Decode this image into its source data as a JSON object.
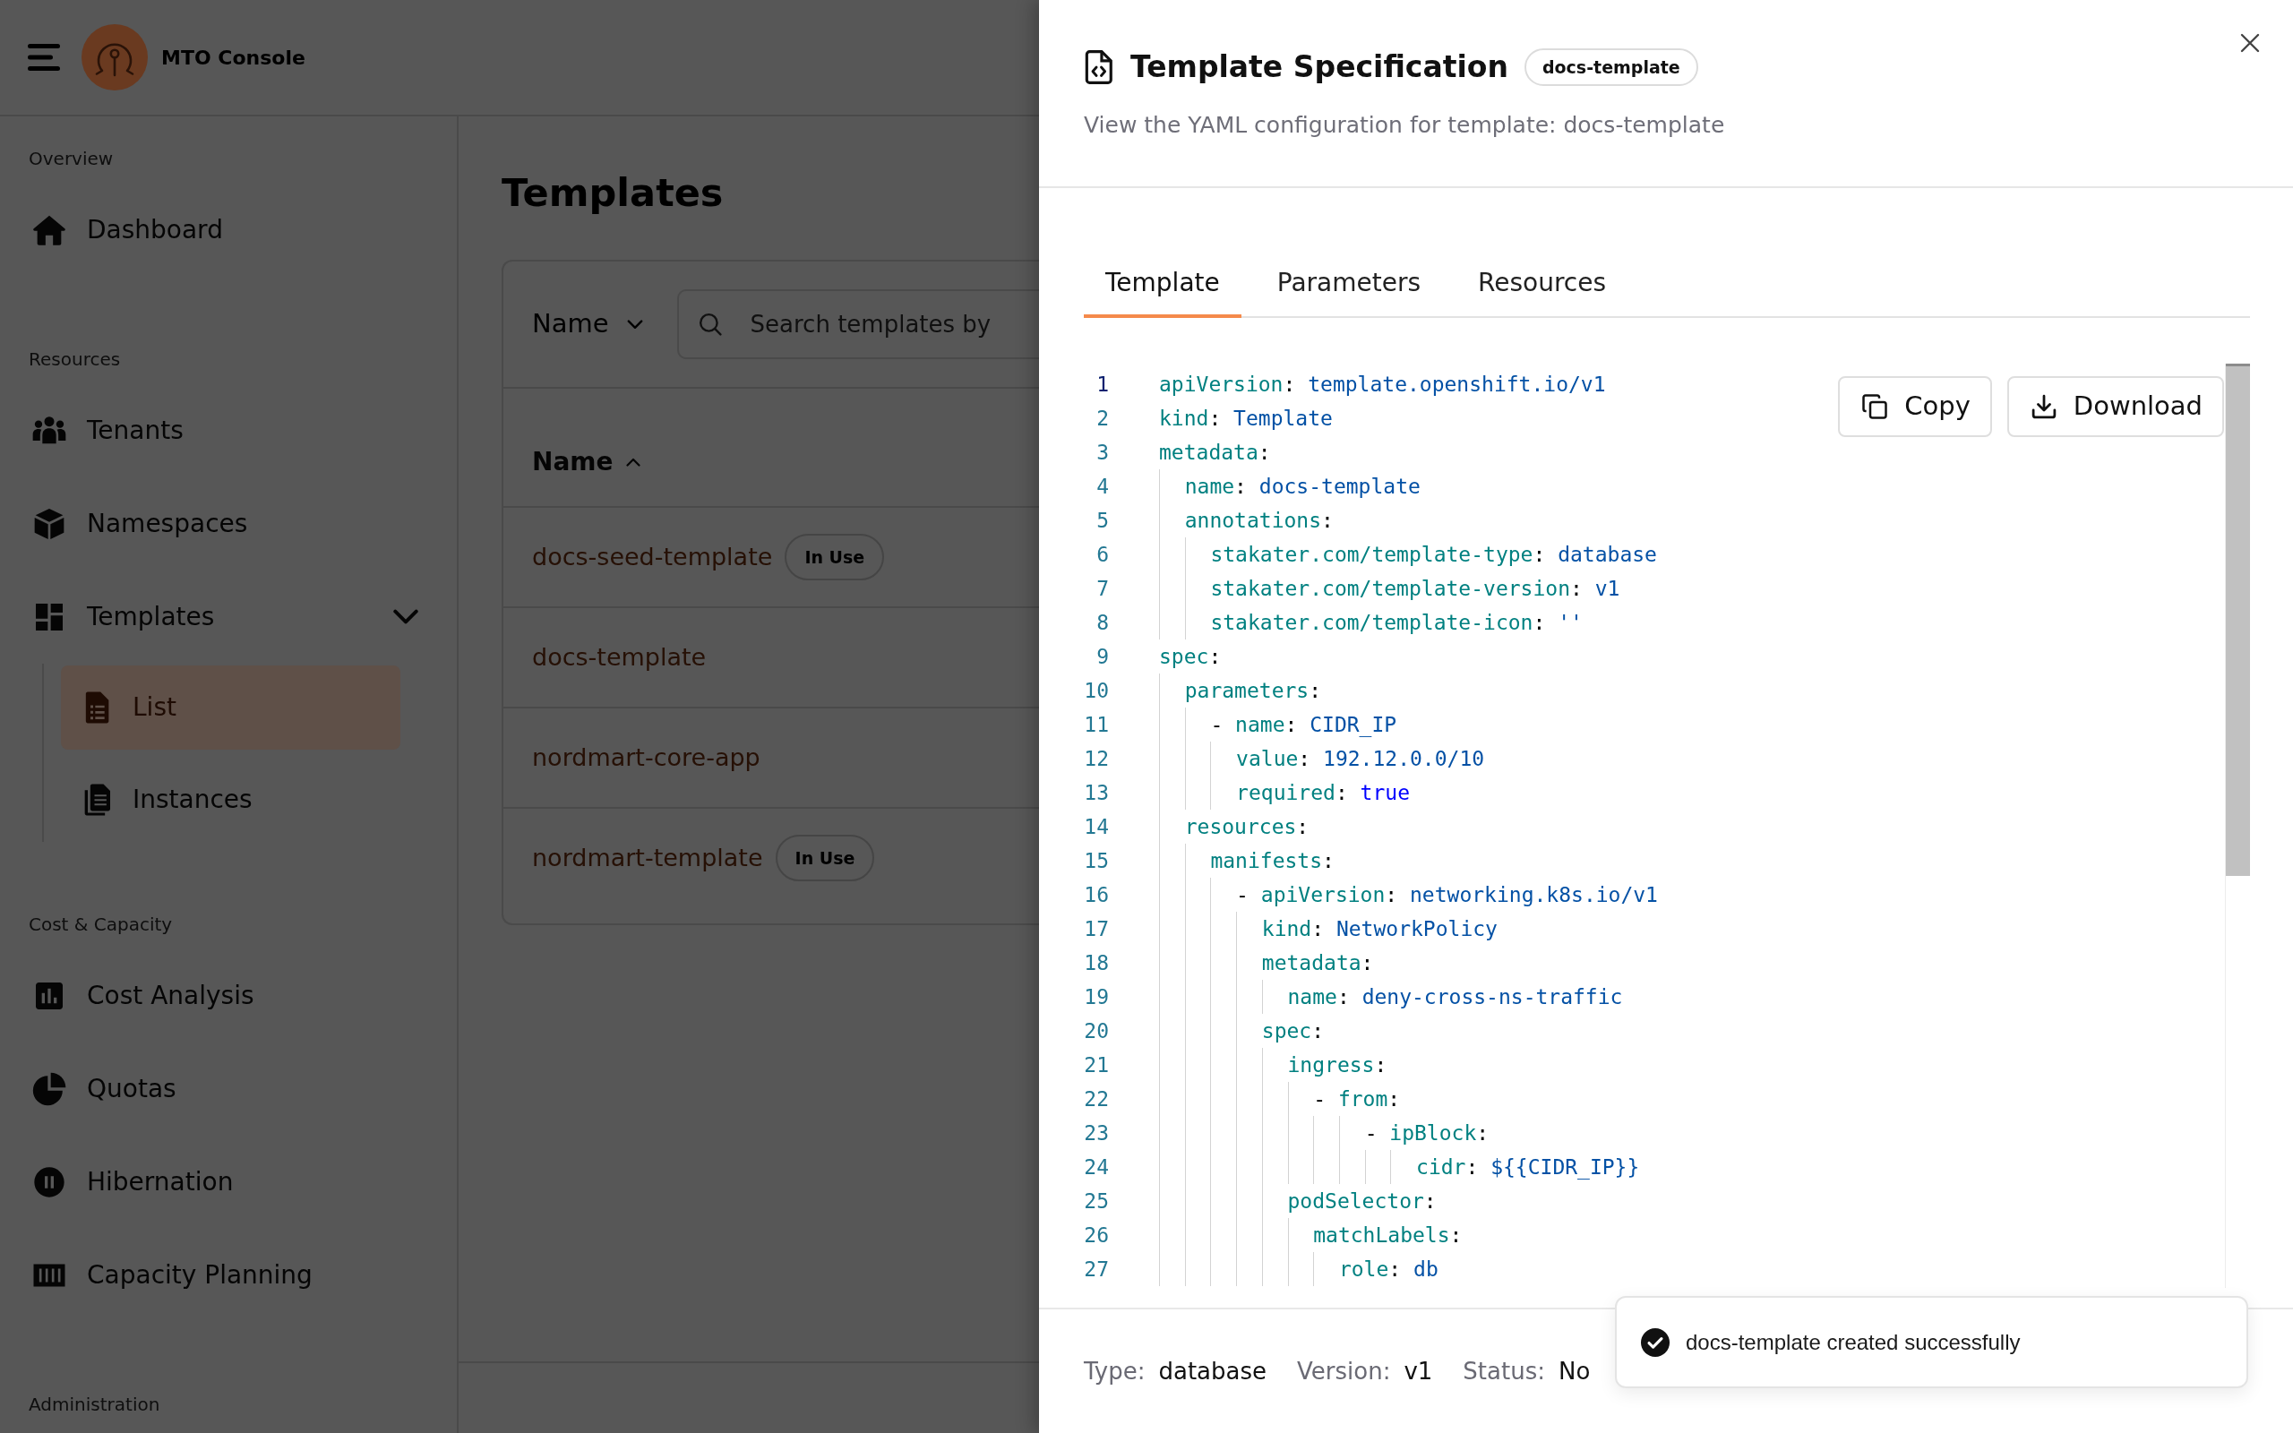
{
  "app": {
    "title": "MTO Console"
  },
  "sidebar": {
    "sections": [
      {
        "label": "Overview",
        "items": [
          {
            "label": "Dashboard",
            "selected": false
          }
        ]
      },
      {
        "label": "Resources",
        "items": [
          {
            "label": "Tenants",
            "selected": false
          },
          {
            "label": "Namespaces",
            "selected": false
          },
          {
            "label": "Templates",
            "selected": false,
            "expanded": true,
            "children": [
              {
                "label": "List",
                "selected": true
              },
              {
                "label": "Instances",
                "selected": false
              }
            ]
          }
        ]
      },
      {
        "label": "Cost & Capacity",
        "items": [
          {
            "label": "Cost Analysis",
            "selected": false
          },
          {
            "label": "Quotas",
            "selected": false
          },
          {
            "label": "Hibernation",
            "selected": false
          },
          {
            "label": "Capacity Planning",
            "selected": false
          }
        ]
      },
      {
        "label": "Administration"
      }
    ]
  },
  "page": {
    "title": "Templates",
    "filter": {
      "field": "Name",
      "placeholder": "Search templates by"
    },
    "table": {
      "columns": [
        {
          "label": "Name",
          "sort_ascending": true
        }
      ],
      "rows": [
        {
          "name": "docs-seed-template",
          "badge": "In Use"
        },
        {
          "name": "docs-template"
        },
        {
          "name": "nordmart-core-app"
        },
        {
          "name": "nordmart-template",
          "badge": "In Use"
        }
      ]
    }
  },
  "drawer": {
    "title": "Template Specification",
    "badge": "docs-template",
    "subtitle": "View the YAML configuration for template: docs-template",
    "tabs": [
      {
        "label": "Template",
        "selected": true
      },
      {
        "label": "Parameters",
        "selected": false
      },
      {
        "label": "Resources",
        "selected": false
      }
    ],
    "editor": {
      "actions": [
        "Copy",
        "Download"
      ],
      "lines": [
        {
          "number": "1",
          "text": "apiVersion: template.openshift.io/v1",
          "kind": "string",
          "active": true
        },
        {
          "number": "2",
          "text": "kind: Template",
          "kind": "string",
          "active": false
        },
        {
          "number": "3",
          "text": "metadata:",
          "kind": "mapping",
          "active": false
        },
        {
          "number": "4",
          "text": "  name: docs-template",
          "kind": "string",
          "active": false
        },
        {
          "number": "5",
          "text": "  annotations:",
          "kind": "mapping",
          "active": false
        },
        {
          "number": "6",
          "text": "    stakater.com/template-type: database",
          "kind": "string",
          "active": false
        },
        {
          "number": "7",
          "text": "    stakater.com/template-version: v1",
          "kind": "string",
          "active": false
        },
        {
          "number": "8",
          "text": "    stakater.com/template-icon: ''",
          "kind": "string",
          "active": false
        },
        {
          "number": "9",
          "text": "spec:",
          "kind": "mapping",
          "active": false
        },
        {
          "number": "10",
          "text": "  parameters:",
          "kind": "mapping",
          "active": false
        },
        {
          "number": "11",
          "text": "    - name: CIDR_IP",
          "kind": "string",
          "active": false
        },
        {
          "number": "12",
          "text": "      value: 192.12.0.0/10",
          "kind": "string",
          "active": false
        },
        {
          "number": "13",
          "text": "      required: true",
          "kind": "boolean",
          "active": false
        },
        {
          "number": "14",
          "text": "  resources:",
          "kind": "mapping",
          "active": false
        },
        {
          "number": "15",
          "text": "    manifests:",
          "kind": "mapping",
          "active": false
        },
        {
          "number": "16",
          "text": "      - apiVersion: networking.k8s.io/v1",
          "kind": "string",
          "active": false
        },
        {
          "number": "17",
          "text": "        kind: NetworkPolicy",
          "kind": "string",
          "active": false
        },
        {
          "number": "18",
          "text": "        metadata:",
          "kind": "mapping",
          "active": false
        },
        {
          "number": "19",
          "text": "          name: deny-cross-ns-traffic",
          "kind": "string",
          "active": false
        },
        {
          "number": "20",
          "text": "        spec:",
          "kind": "mapping",
          "active": false
        },
        {
          "number": "21",
          "text": "          ingress:",
          "kind": "mapping",
          "active": false
        },
        {
          "number": "22",
          "text": "            - from:",
          "kind": "mapping",
          "active": false
        },
        {
          "number": "23",
          "text": "                - ipBlock:",
          "kind": "mapping",
          "active": false
        },
        {
          "number": "24",
          "text": "                    cidr: ${{CIDR_IP}}",
          "kind": "string",
          "active": false
        },
        {
          "number": "25",
          "text": "          podSelector:",
          "kind": "mapping",
          "active": false
        },
        {
          "number": "26",
          "text": "            matchLabels:",
          "kind": "mapping",
          "active": false
        },
        {
          "number": "27",
          "text": "              role: db",
          "kind": "string",
          "active": false
        }
      ]
    },
    "details": [
      {
        "label": "Type:",
        "value": "database"
      },
      {
        "label": "Version:",
        "value": "v1"
      },
      {
        "label": "Status:",
        "value": "No"
      }
    ]
  },
  "toast": {
    "message": "docs-template created successfully"
  }
}
